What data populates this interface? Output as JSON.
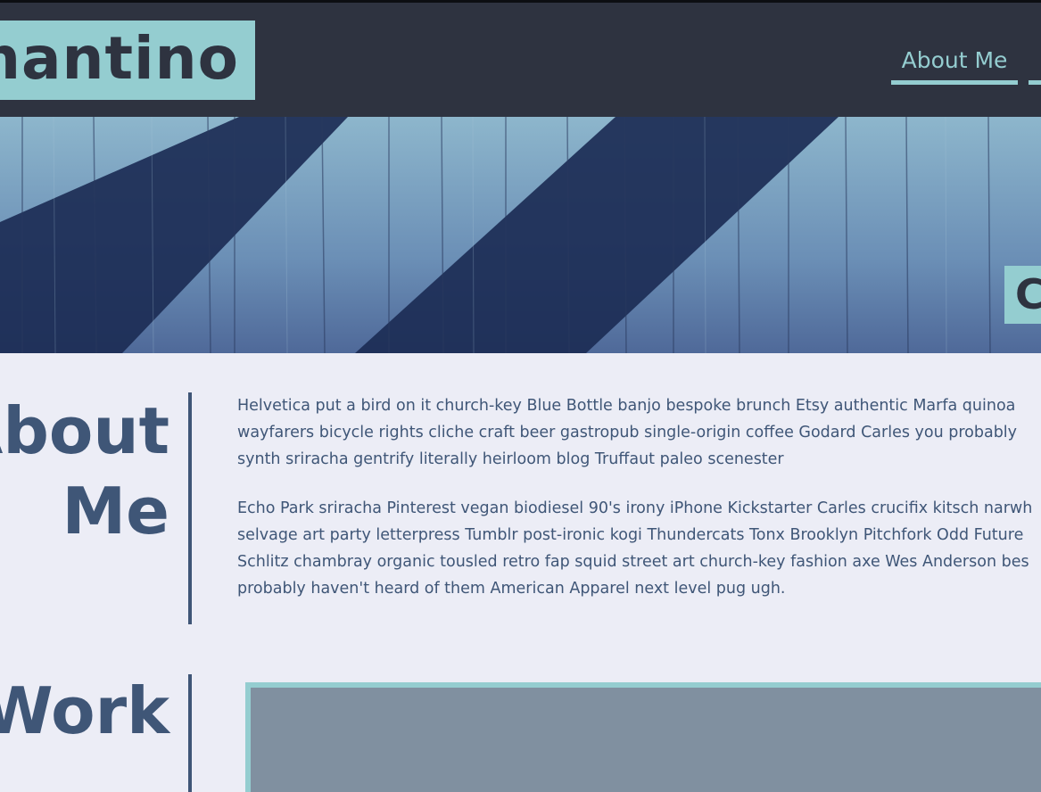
{
  "header": {
    "logo_text": "nantino",
    "nav": {
      "about": "About Me"
    }
  },
  "hero": {
    "badge_text": "C"
  },
  "about": {
    "title_line1": "About",
    "title_line2": "Me",
    "paragraph1": [
      "Helvetica put a bird on it church-key Blue Bottle banjo bespoke brunch Etsy authentic Marfa quinoa",
      "wayfarers bicycle rights cliche craft beer gastropub single-origin coffee Godard Carles you probably",
      "synth sriracha gentrify literally heirloom blog Truffaut paleo scenester"
    ],
    "paragraph2": [
      "Echo Park sriracha Pinterest vegan biodiesel 90's irony iPhone Kickstarter Carles crucifix kitsch narwh",
      "selvage art party letterpress Tumblr post-ironic kogi Thundercats Tonx Brooklyn Pitchfork Odd Future",
      "Schlitz chambray organic tousled retro fap squid street art church-key fashion axe Wes Anderson bes",
      "probably haven't heard of them American Apparel next level pug ugh."
    ]
  },
  "work": {
    "title": "Work"
  },
  "colors": {
    "header_bg": "#2e3340",
    "accent": "#94cdd0",
    "text": "#3f5677",
    "page_bg": "#ecedf6"
  }
}
